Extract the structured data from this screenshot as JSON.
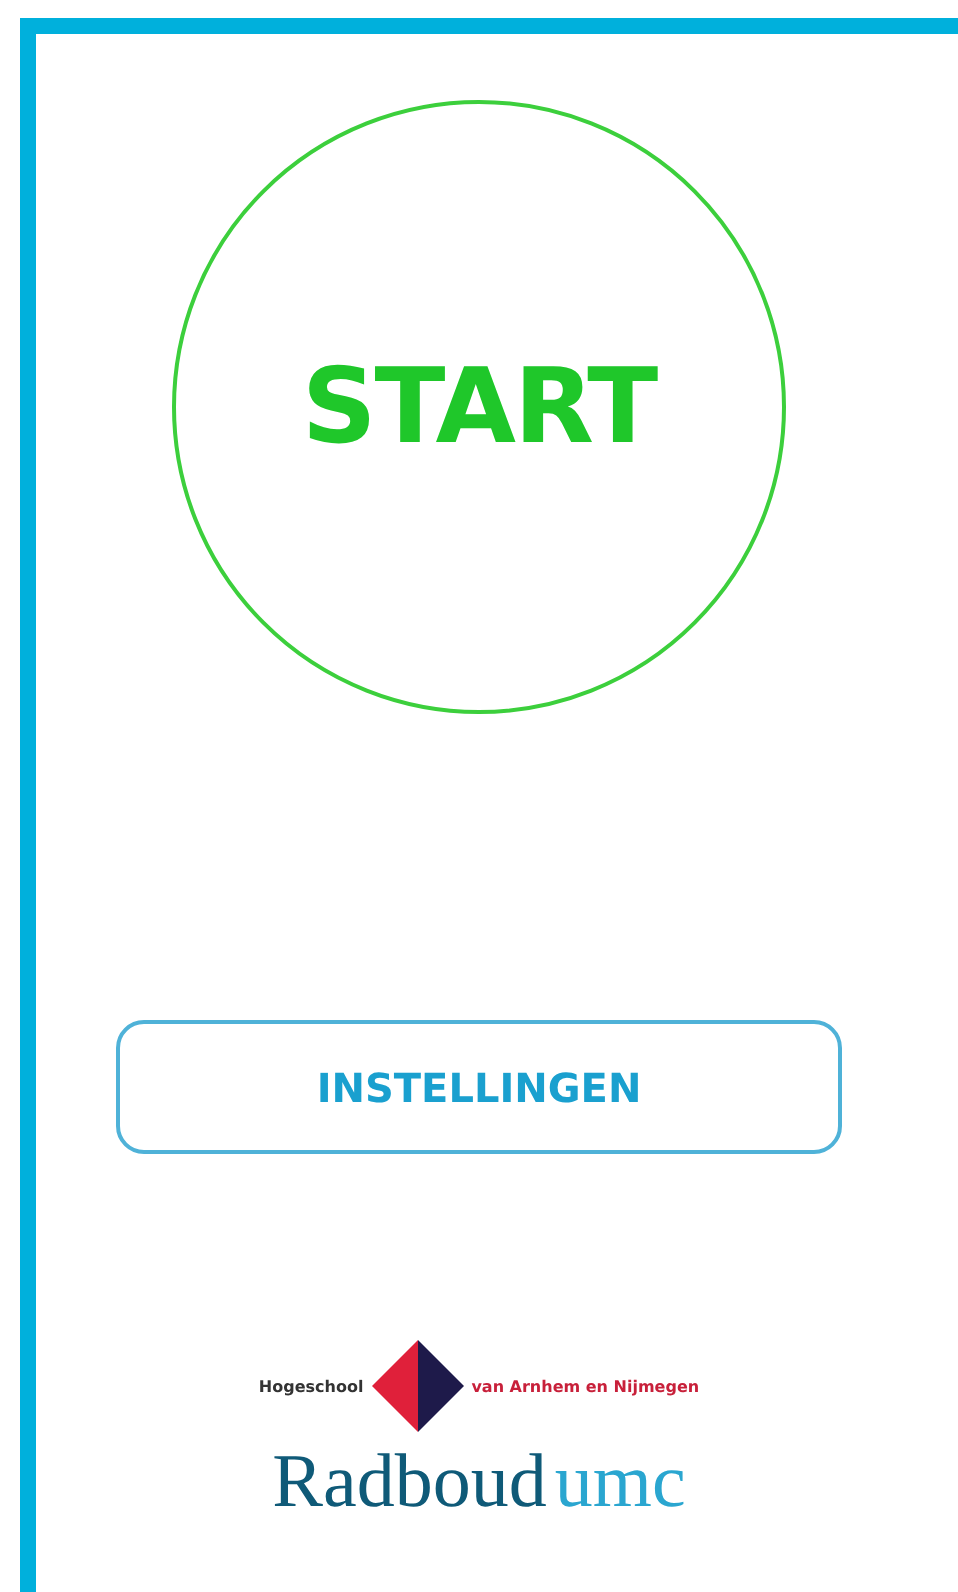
{
  "start_button": {
    "label": "START"
  },
  "settings_button": {
    "label": "INSTELLINGEN"
  },
  "logos": {
    "hogeschool": {
      "left": "Hogeschool",
      "right": "van Arnhem en Nijmegen"
    },
    "radboud": {
      "main": "Radboud",
      "suffix": "umc"
    }
  }
}
